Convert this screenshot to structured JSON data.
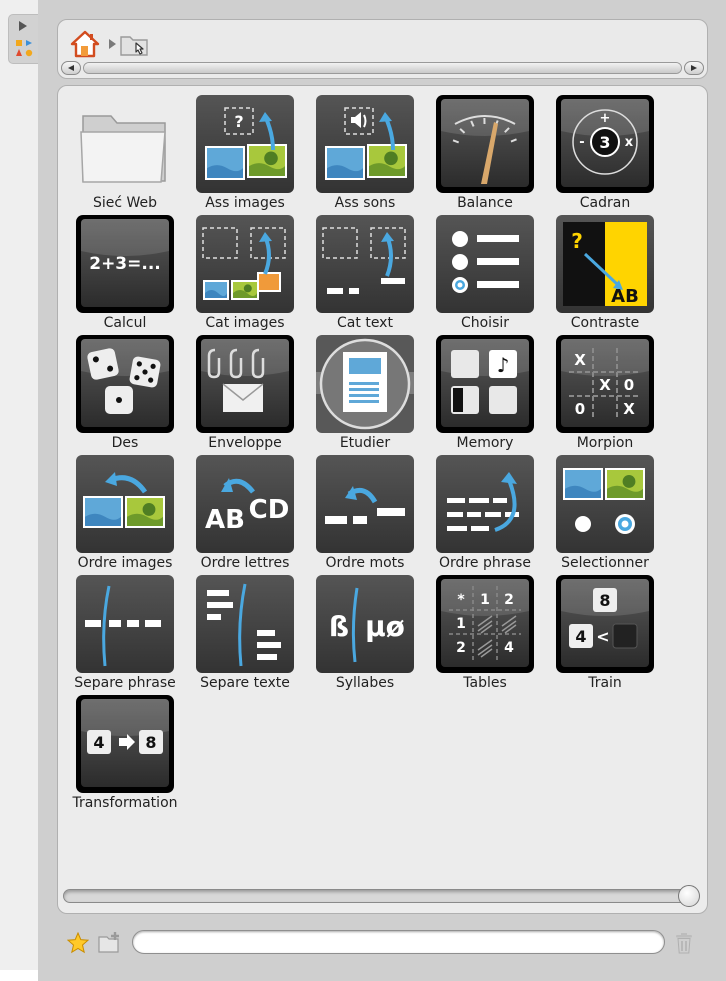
{
  "window": {
    "title": ""
  },
  "breadcrumb": {
    "root": "home-icon",
    "current": "folder-icon"
  },
  "items": [
    {
      "label": "Sieć Web",
      "icon": "folder-icon"
    },
    {
      "label": "Ass images",
      "icon": "ass-images-icon"
    },
    {
      "label": "Ass sons",
      "icon": "ass-sons-icon"
    },
    {
      "label": "Balance",
      "icon": "balance-icon"
    },
    {
      "label": "Cadran",
      "icon": "cadran-icon"
    },
    {
      "label": "Calcul",
      "icon": "calcul-icon"
    },
    {
      "label": "Cat images",
      "icon": "cat-images-icon"
    },
    {
      "label": "Cat text",
      "icon": "cat-text-icon"
    },
    {
      "label": "Choisir",
      "icon": "choisir-icon"
    },
    {
      "label": "Contraste",
      "icon": "contraste-icon"
    },
    {
      "label": "Des",
      "icon": "dice-icon"
    },
    {
      "label": "Enveloppe",
      "icon": "envelope-icon"
    },
    {
      "label": "Etudier",
      "icon": "document-icon"
    },
    {
      "label": "Memory",
      "icon": "memory-icon"
    },
    {
      "label": "Morpion",
      "icon": "tic-tac-toe-icon"
    },
    {
      "label": "Ordre images",
      "icon": "ordre-images-icon"
    },
    {
      "label": "Ordre lettres",
      "icon": "ordre-lettres-icon"
    },
    {
      "label": "Ordre mots",
      "icon": "ordre-mots-icon"
    },
    {
      "label": "Ordre phrase",
      "icon": "ordre-phrase-icon"
    },
    {
      "label": "Selectionner",
      "icon": "selectionner-icon"
    },
    {
      "label": "Separe phrase",
      "icon": "separe-phrase-icon"
    },
    {
      "label": "Separe texte",
      "icon": "separe-texte-icon"
    },
    {
      "label": "Syllabes",
      "icon": "syllabes-icon"
    },
    {
      "label": "Tables",
      "icon": "tables-icon"
    },
    {
      "label": "Train",
      "icon": "train-icon"
    },
    {
      "label": "Transformation",
      "icon": "transformation-icon"
    }
  ],
  "tile_text": {
    "question": "?",
    "calc": "2+3=...",
    "dial_center": "3",
    "dial_plus": "+",
    "dial_minus": "-",
    "dial_times": "x",
    "contrast_q": "?",
    "contrast_ab": "AB",
    "letters_ab": "AB",
    "letters_cd": "CD",
    "syll_left": "ß",
    "syll_right": "μø",
    "tables": [
      "*",
      "1",
      "2",
      "1",
      "",
      "",
      "2",
      "",
      "4"
    ],
    "train_top": "8",
    "train_left": "4",
    "train_op": "<",
    "trans_left": "4",
    "trans_right": "8",
    "ttt_x": "X",
    "ttt_o": "0"
  },
  "search": {
    "value": "",
    "placeholder": ""
  },
  "colors": {
    "accent": "#4aa8e0",
    "tile_dark": "#3a3a3a",
    "yellow": "#ffd400",
    "panel": "#ececec"
  }
}
